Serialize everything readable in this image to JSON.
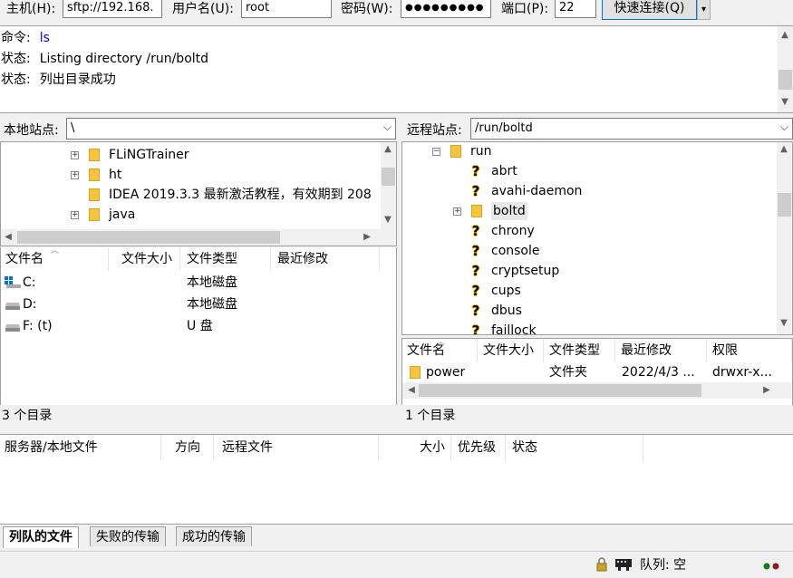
{
  "toolbar": {
    "host_label": "主机(H):",
    "host_value": "sftp://192.168.",
    "user_label": "用户名(U):",
    "user_value": "root",
    "pass_label": "密码(W):",
    "pass_value": "●●●●●●●●●",
    "port_label": "端口(P):",
    "port_value": "22",
    "connect_label": "快速连接(Q)",
    "dropdown_icon": "▾"
  },
  "log": [
    {
      "label": "命令:",
      "text": "ls",
      "color": "#0000ff"
    },
    {
      "label": "状态:",
      "text": "Listing directory /run/boltd",
      "color": "#000000"
    },
    {
      "label": "状态:",
      "text": "列出目录成功",
      "color": "#000000"
    }
  ],
  "local": {
    "site_label": "本地站点:",
    "path": "\\",
    "tree": [
      {
        "name": "FLiNGTrainer",
        "expandable": true
      },
      {
        "name": "ht",
        "expandable": true
      },
      {
        "name": "IDEA 2019.3.3 最新激活教程，有效期到 208",
        "expandable": false
      },
      {
        "name": "java",
        "expandable": true
      }
    ],
    "columns": [
      "文件名",
      "文件大小",
      "文件类型",
      "最近修改"
    ],
    "files": [
      {
        "name": "C:",
        "type": "本地磁盘",
        "icon": "windows-drive-icon"
      },
      {
        "name": "D:",
        "type": "本地磁盘",
        "icon": "drive-icon"
      },
      {
        "name": "F: (t)",
        "type": "U 盘",
        "icon": "drive-icon"
      }
    ],
    "status": "3 个目录"
  },
  "remote": {
    "site_label": "远程站点:",
    "path": "/run/boltd",
    "tree_root": "run",
    "tree": [
      {
        "name": "abrt",
        "kind": "unknown"
      },
      {
        "name": "avahi-daemon",
        "kind": "unknown"
      },
      {
        "name": "boltd",
        "kind": "folder",
        "selected": true
      },
      {
        "name": "chrony",
        "kind": "unknown"
      },
      {
        "name": "console",
        "kind": "unknown"
      },
      {
        "name": "cryptsetup",
        "kind": "unknown"
      },
      {
        "name": "cups",
        "kind": "unknown"
      },
      {
        "name": "dbus",
        "kind": "unknown"
      },
      {
        "name": "faillock",
        "kind": "unknown"
      }
    ],
    "columns": [
      "文件名",
      "文件大小",
      "文件类型",
      "最近修改",
      "权限"
    ],
    "files": [
      {
        "name": "power",
        "size": "",
        "type": "文件夹",
        "modified": "2022/4/3 ...",
        "perms": "drwxr-x..."
      }
    ],
    "status": "1 个目录"
  },
  "queue": {
    "columns": [
      "服务器/本地文件",
      "方向",
      "远程文件",
      "大小",
      "优先级",
      "状态"
    ],
    "tabs": [
      "列队的文件",
      "失败的传输",
      "成功的传输"
    ],
    "active_tab": 0
  },
  "statusbar": {
    "queue_text": "队列: 空"
  }
}
